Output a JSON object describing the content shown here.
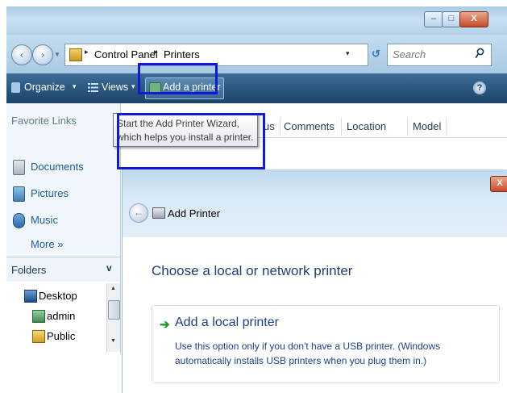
{
  "window_printers": {
    "caption_buttons": {
      "minimize": "–",
      "maximize": "□",
      "close": "X"
    },
    "address": {
      "segments": [
        "Control Panel",
        "Printers"
      ],
      "separator": "▸",
      "dropdown": "▾",
      "refresh_icon": "refresh-icon"
    },
    "search": {
      "placeholder": "Search"
    },
    "toolbar": {
      "organize": "Organize",
      "views": "Views",
      "add_printer": "Add a printer",
      "caret": "▾",
      "help": "?"
    },
    "sidebar": {
      "favorite_links_title": "Favorite Links",
      "favorites": [
        "Documents",
        "Pictures",
        "Music"
      ],
      "more": "More  »",
      "folders_title": "Folders",
      "folders_chevron": "v",
      "tree": [
        "Desktop",
        "admin",
        "Public"
      ]
    },
    "columns": [
      "us",
      "Comments",
      "Location",
      "Model"
    ],
    "tooltip": "Start the Add Printer Wizard, which helps you install a printer."
  },
  "window_add_printer": {
    "close": "X",
    "back_arrow": "←",
    "title": "Add Printer",
    "heading": "Choose a local or network printer",
    "options": [
      {
        "arrow": "➔",
        "title": "Add a local printer",
        "description": "Use this option only if you don't have a USB printer. (Windows automatically installs USB printers when you plug them in.)"
      }
    ]
  },
  "colors": {
    "toolbar": "#2b5880",
    "highlight_box": "#1118d8",
    "link": "#1d5b9e",
    "wizard_text": "#1b3f8c",
    "green_arrow": "#1f9e2f"
  }
}
